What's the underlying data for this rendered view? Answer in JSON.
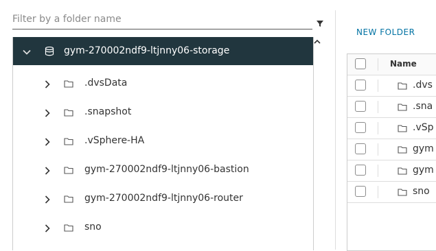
{
  "filter": {
    "placeholder": "Filter by a folder name"
  },
  "tree": {
    "root": {
      "label": "gym-270002ndf9-ltjnny06-storage",
      "expanded": true,
      "icon": "database-icon"
    },
    "children": [
      {
        "label": ".dvsData",
        "icon": "folder-icon"
      },
      {
        "label": ".snapshot",
        "icon": "folder-icon"
      },
      {
        "label": ".vSphere-HA",
        "icon": "folder-icon"
      },
      {
        "label": "gym-270002ndf9-ltjnny06-bastion",
        "icon": "folder-icon"
      },
      {
        "label": "gym-270002ndf9-ltjnny06-router",
        "icon": "folder-icon"
      },
      {
        "label": "sno",
        "icon": "folder-icon"
      }
    ]
  },
  "actions": {
    "new_folder": "NEW FOLDER"
  },
  "grid": {
    "columns": [
      "Name"
    ],
    "rows": [
      {
        "name": ".dvs"
      },
      {
        "name": ".sna"
      },
      {
        "name": ".vSp"
      },
      {
        "name": "gym"
      },
      {
        "name": "gym"
      },
      {
        "name": "sno"
      }
    ]
  },
  "colors": {
    "selected_bg": "#21363e",
    "link": "#0072a3"
  }
}
